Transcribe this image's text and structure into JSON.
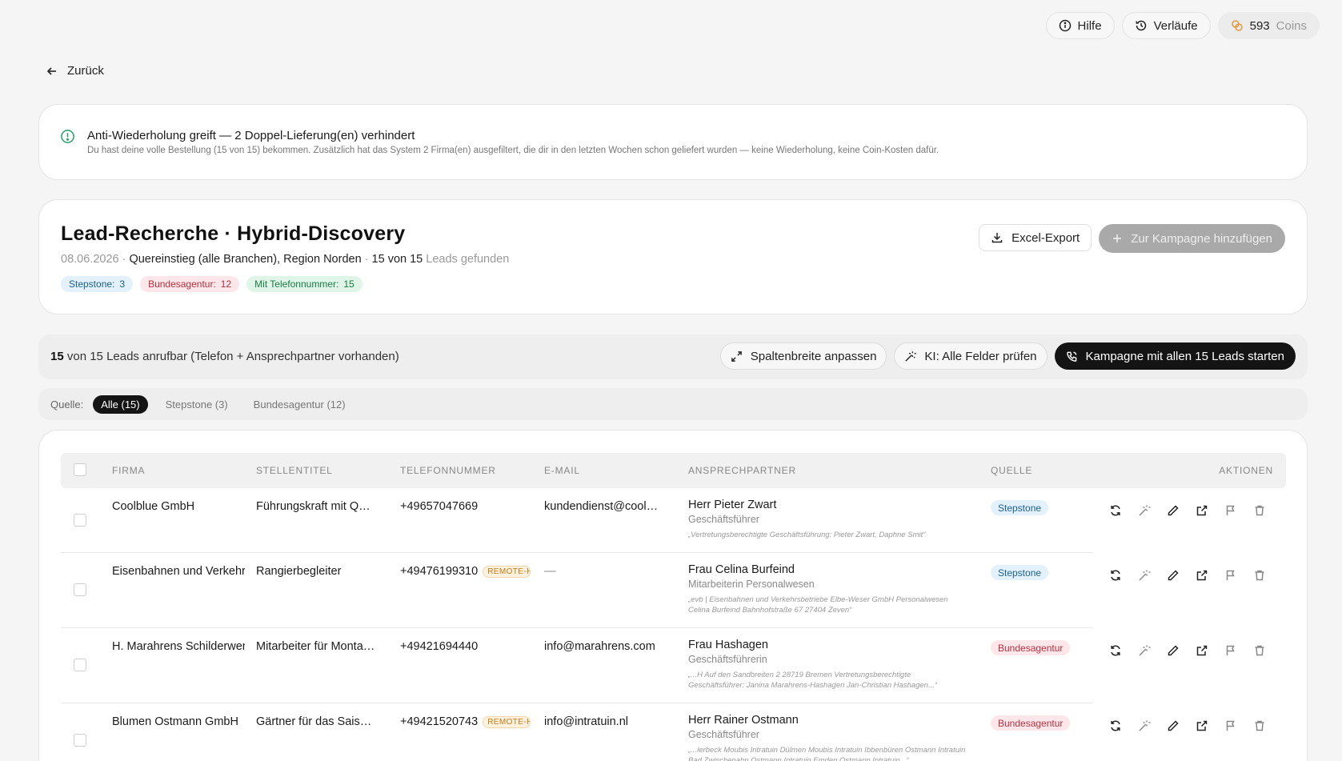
{
  "topbar": {
    "help": "Hilfe",
    "history": "Verläufe",
    "coins_value": "593",
    "coins_label": "Coins"
  },
  "nav": {
    "back": "Zurück"
  },
  "alert": {
    "title": "Anti-Wiederholung greift — 2 Doppel-Lieferung(en) verhindert",
    "text": "Du hast deine volle Bestellung (15 von 15) bekommen. Zusätzlich hat das System 2 Firma(en) ausgefiltert, die dir in den letzten Wochen schon geliefert wurden — keine Wiederholung, keine Coin-Kosten dafür."
  },
  "header": {
    "title": "Lead-Recherche · Hybrid-Discovery",
    "date": "08.06.2026 ·",
    "query": "Quereinstieg (alle Branchen), Region Norden",
    "sep": "·",
    "count": "15 von 15",
    "count_suffix": "Leads gefunden",
    "tags": [
      {
        "label": "Stepstone:",
        "value": "3"
      },
      {
        "label": "Bundesagentur:",
        "value": "12"
      },
      {
        "label": "Mit Telefonnummer:",
        "value": "15"
      }
    ],
    "export": "Excel-Export",
    "add_campaign": "Zur Kampagne hinzufügen"
  },
  "strip": {
    "count": "15",
    "text": "von 15 Leads anrufbar (Telefon + Ansprechpartner vorhanden)",
    "fit": "Spaltenbreite anpassen",
    "ai": "KI: Alle Felder prüfen",
    "start": "Kampagne mit allen 15 Leads starten"
  },
  "filter": {
    "label": "Quelle:",
    "chips": [
      "Alle (15)",
      "Stepstone (3)",
      "Bundesagentur (12)"
    ]
  },
  "table": {
    "columns": [
      "FIRMA",
      "STELLENTITEL",
      "TELEFONNUMMER",
      "E-MAIL",
      "ANSPRECHPARTNER",
      "QUELLE",
      "AKTIONEN"
    ],
    "rows": [
      {
        "company": "Coolblue GmbH",
        "job": "Führungskraft mit Quereinstieg",
        "phone": "+49657047669",
        "remote": "",
        "email": "kundendienst@coolblue.de",
        "contact_name": "Herr Pieter Zwart",
        "contact_role": "Geschäftsführer",
        "contact_quote": "„Vertretungsberechtigte Geschäftsführung: Pieter Zwart, Daphne Smit“",
        "source": "Stepstone"
      },
      {
        "company": "Eisenbahnen und Verkehrsbetriebe Elbe-Weser GmbH",
        "job": "Rangierbegleiter",
        "phone": "+49476199310",
        "remote": "REMOTE-HOME",
        "email": "—",
        "contact_name": "Frau Celina Burfeind",
        "contact_role": "Mitarbeiterin Personalwesen",
        "contact_quote": "„evb | Eisenbahnen und Verkehrsbetriebe Elbe-Weser GmbH Personalwesen Celina Burfeind Bahnhofstraße 67 27404 Zeven“",
        "source": "Stepstone"
      },
      {
        "company": "H. Marahrens Schilderwerk GmbH",
        "job": "Mitarbeiter für Montage (m/w/d)",
        "phone": "+49421694440",
        "remote": "",
        "email": "info@marahrens.com",
        "contact_name": "Frau Hashagen",
        "contact_role": "Geschäftsführerin",
        "contact_quote": "„...H Auf den Sandbreiten 2 28719 Bremen Vertretungsberechtigte Geschäftsführer: Janina Marahrens-Hashagen Jan-Christian Hashagen...“",
        "source": "Bundesagentur"
      },
      {
        "company": "Blumen Ostmann GmbH",
        "job": "Gärtner für das Saisongeschäft",
        "phone": "+49421520743",
        "remote": "REMOTE-HOME",
        "email": "info@intratuin.nl",
        "contact_name": "Herr Rainer Ostmann",
        "contact_role": "Geschäftsführer",
        "contact_quote": "„...lerbeck Moubis Intratuin Dülmen Moubis Intratuin Ibbenbüren Ostmann Intratuin Bad Zwischenahn Ostmann Intratuin Emden Ostmann Intratuin...“",
        "source": "Bundesagentur"
      }
    ]
  },
  "colors": {
    "accent_dark": "#141414",
    "stepstone": "#1c5f8e",
    "bundesagentur": "#b5303f",
    "phone_ok": "#1d7a45",
    "alert_icon": "#22a06b"
  },
  "icons": [
    "info-icon",
    "history-icon",
    "coins-icon",
    "arrow-left-icon",
    "alert-circle-icon",
    "download-icon",
    "plus-icon",
    "expand-icon",
    "magic-wand-icon",
    "phone-icon",
    "refresh-icon",
    "edit-icon",
    "external-link-icon",
    "flag-icon",
    "trash-icon"
  ]
}
